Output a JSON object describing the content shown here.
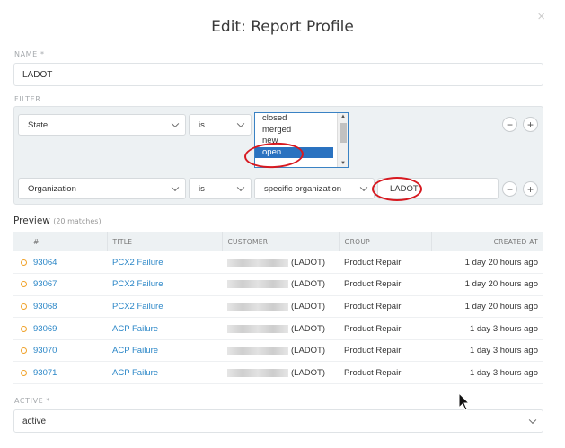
{
  "modal": {
    "title": "Edit: Report Profile",
    "close": "×"
  },
  "name": {
    "label": "NAME *",
    "value": "LADOT"
  },
  "filter": {
    "label": "FILTER",
    "rows": [
      {
        "attribute": "State",
        "operator": "is",
        "options": [
          "closed",
          "merged",
          "new",
          "open"
        ],
        "selected": "open"
      },
      {
        "attribute": "Organization",
        "operator": "is",
        "value_type": "specific organization",
        "value": "LADOT"
      }
    ],
    "minus": "−",
    "plus": "+"
  },
  "preview": {
    "title": "Preview",
    "matches": "(20 matches)",
    "columns": [
      "#",
      "TITLE",
      "CUSTOMER",
      "GROUP",
      "CREATED AT"
    ],
    "rows": [
      {
        "number": "93064",
        "title": "PCX2 Failure",
        "customer": "(LADOT)",
        "group": "Product Repair",
        "created": "1 day 20 hours ago"
      },
      {
        "number": "93067",
        "title": "PCX2 Failure",
        "customer": "(LADOT)",
        "group": "Product Repair",
        "created": "1 day 20 hours ago"
      },
      {
        "number": "93068",
        "title": "PCX2 Failure",
        "customer": "(LADOT)",
        "group": "Product Repair",
        "created": "1 day 20 hours ago"
      },
      {
        "number": "93069",
        "title": "ACP Failure",
        "customer": "(LADOT)",
        "group": "Product Repair",
        "created": "1 day 3 hours ago"
      },
      {
        "number": "93070",
        "title": "ACP Failure",
        "customer": "(LADOT)",
        "group": "Product Repair",
        "created": "1 day 3 hours ago"
      },
      {
        "number": "93071",
        "title": "ACP Failure",
        "customer": "(LADOT)",
        "group": "Product Repair",
        "created": "1 day 3 hours ago"
      }
    ]
  },
  "active": {
    "label": "ACTIVE *",
    "value": "active"
  },
  "colors": {
    "link": "#2a86c7",
    "status_dot": "#f0a22a",
    "highlight": "#d71920",
    "selected_option": "#2a72c0"
  },
  "icons": {
    "close": "close-icon",
    "chevron": "chevron-down-icon",
    "status": "ticket-status-icon",
    "pointer": "mouse-pointer-icon"
  }
}
